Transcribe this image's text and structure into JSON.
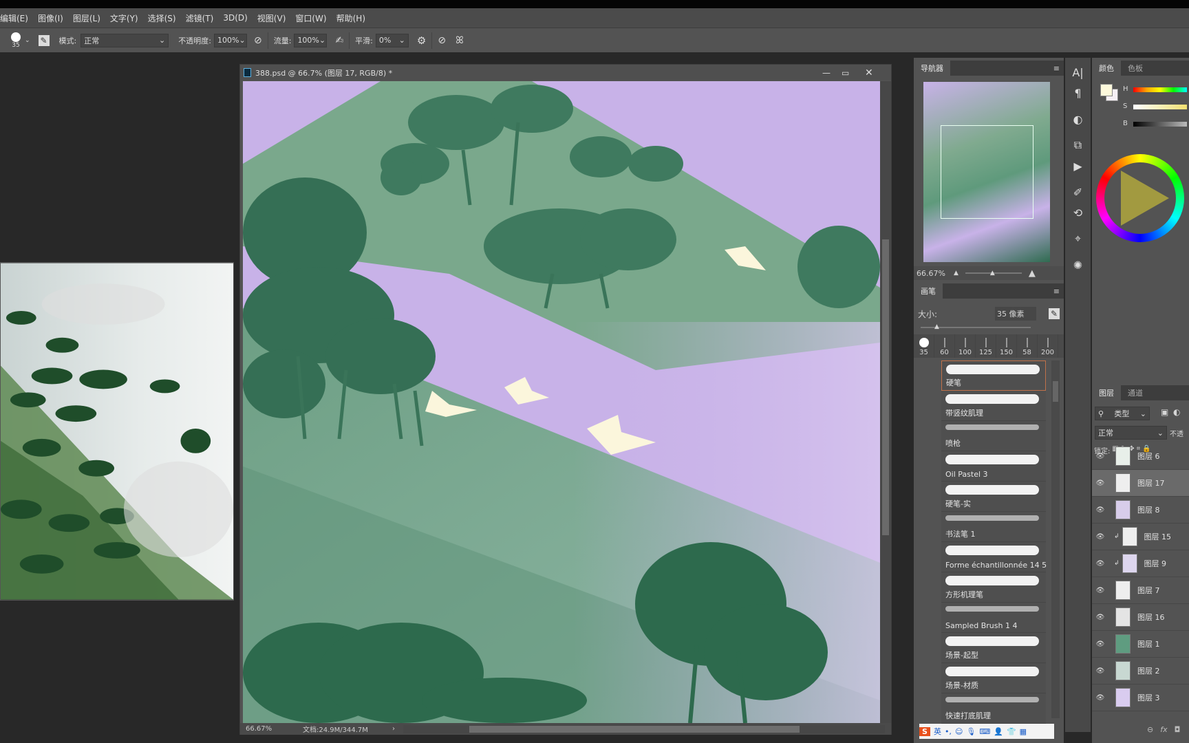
{
  "menu": [
    "编辑(E)",
    "图像(I)",
    "图层(L)",
    "文字(Y)",
    "选择(S)",
    "滤镜(T)",
    "3D(D)",
    "视图(V)",
    "窗口(W)",
    "帮助(H)"
  ],
  "options": {
    "brush_size": "35",
    "mode_label": "模式:",
    "mode_value": "正常",
    "opacity_label": "不透明度:",
    "opacity_value": "100%",
    "flow_label": "流量:",
    "flow_value": "100%",
    "smoothing_label": "平滑:",
    "smoothing_value": "0%"
  },
  "document": {
    "title": "388.psd @ 66.7% (图层 17, RGB/8) *",
    "zoom": "66.67%",
    "doc_size": "文档:24.9M/344.7M"
  },
  "navigator": {
    "tab": "导航器",
    "zoom": "66.67%"
  },
  "brush_panel": {
    "tab": "画笔",
    "size_label": "大小:",
    "size_value": "35 像素",
    "presets": [
      "35",
      "60",
      "100",
      "125",
      "150",
      "58",
      "200"
    ],
    "brushes": [
      "硬笔",
      "带竖纹肌理",
      "喷枪",
      "Oil Pastel 3",
      "硬笔-实",
      "书法笔 1",
      "Forme échantillonnée 14 5",
      "方形机理笔",
      "Sampled Brush 1 4",
      "场景-起型",
      "场景-材质",
      "快速打底肌理"
    ],
    "selected_brush": "硬笔"
  },
  "ime_bar": {
    "lang": "英"
  },
  "color_panel": {
    "tabs": [
      "颜色",
      "色板"
    ],
    "sliders": [
      "H",
      "S",
      "B"
    ],
    "foreground": "#fdf9dc",
    "background": "#f6f0f4"
  },
  "layers_panel": {
    "tabs": [
      "图层",
      "通道"
    ],
    "filter": "类型",
    "blend_mode": "正常",
    "opacity_label": "不透",
    "lock_label": "锁定:",
    "layers": [
      {
        "name": "图层 6",
        "thumb": "#e8efe9"
      },
      {
        "name": "图层 17",
        "thumb": "#eeeeee",
        "selected": true
      },
      {
        "name": "图层 8",
        "thumb": "#d8cdea"
      },
      {
        "name": "图层 15",
        "thumb": "#eeeeee",
        "clipped": true
      },
      {
        "name": "图层 9",
        "thumb": "#ddd6ee",
        "clipped": true
      },
      {
        "name": "图层 7",
        "thumb": "#eeeeee"
      },
      {
        "name": "图层 16",
        "thumb": "#e4e4e4"
      },
      {
        "name": "图层 1",
        "thumb": "#5f9c80"
      },
      {
        "name": "图层 2",
        "thumb": "#c8d8d2"
      },
      {
        "name": "图层 3",
        "thumb": "#d9ccef"
      }
    ],
    "footer_fx": "fx"
  },
  "colors": {
    "lavender": "#c8b2e8",
    "green": "#5f9a7c",
    "darkgreen": "#2f6b50",
    "bird": "#fbf6dc"
  }
}
